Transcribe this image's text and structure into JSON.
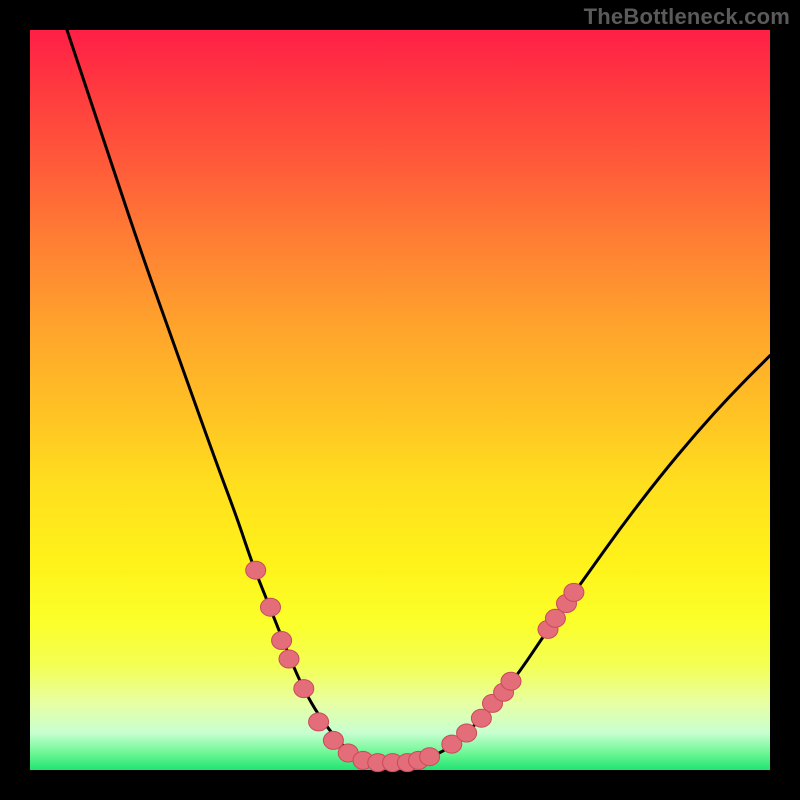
{
  "watermark": "TheBottleneck.com",
  "colors": {
    "curve": "#000000",
    "marker_fill": "#e46d7a",
    "marker_stroke": "#c94a5a",
    "gradient_top": "#ff1f47",
    "gradient_bottom": "#21e374"
  },
  "chart_data": {
    "type": "line",
    "title": "",
    "xlabel": "",
    "ylabel": "",
    "xlim": [
      0,
      100
    ],
    "ylim": [
      0,
      100
    ],
    "grid": false,
    "legend": false,
    "series": [
      {
        "name": "bottleneck-curve",
        "x": [
          5,
          10,
          15,
          20,
          25,
          28,
          30,
          32,
          34,
          36,
          38,
          40,
          42,
          44,
          46,
          48,
          50,
          52,
          55,
          58,
          62,
          66,
          70,
          75,
          80,
          85,
          90,
          95,
          100
        ],
        "y": [
          100,
          85,
          70,
          56,
          42,
          34,
          28,
          23,
          18,
          13,
          9,
          6,
          3.5,
          2,
          1.2,
          1,
          1,
          1.2,
          2,
          4,
          8,
          13,
          19,
          26,
          33,
          39.5,
          45.5,
          51,
          56
        ]
      }
    ],
    "markers": {
      "name": "highlighted-points",
      "points": [
        {
          "x": 30.5,
          "y": 27
        },
        {
          "x": 32.5,
          "y": 22
        },
        {
          "x": 34,
          "y": 17.5
        },
        {
          "x": 35,
          "y": 15
        },
        {
          "x": 37,
          "y": 11
        },
        {
          "x": 39,
          "y": 6.5
        },
        {
          "x": 41,
          "y": 4
        },
        {
          "x": 43,
          "y": 2.3
        },
        {
          "x": 45,
          "y": 1.3
        },
        {
          "x": 47,
          "y": 1
        },
        {
          "x": 49,
          "y": 1
        },
        {
          "x": 51,
          "y": 1
        },
        {
          "x": 52.5,
          "y": 1.3
        },
        {
          "x": 54,
          "y": 1.8
        },
        {
          "x": 57,
          "y": 3.5
        },
        {
          "x": 59,
          "y": 5
        },
        {
          "x": 61,
          "y": 7
        },
        {
          "x": 62.5,
          "y": 9
        },
        {
          "x": 64,
          "y": 10.5
        },
        {
          "x": 65,
          "y": 12
        },
        {
          "x": 70,
          "y": 19
        },
        {
          "x": 71,
          "y": 20.5
        },
        {
          "x": 72.5,
          "y": 22.5
        },
        {
          "x": 73.5,
          "y": 24
        }
      ]
    }
  }
}
